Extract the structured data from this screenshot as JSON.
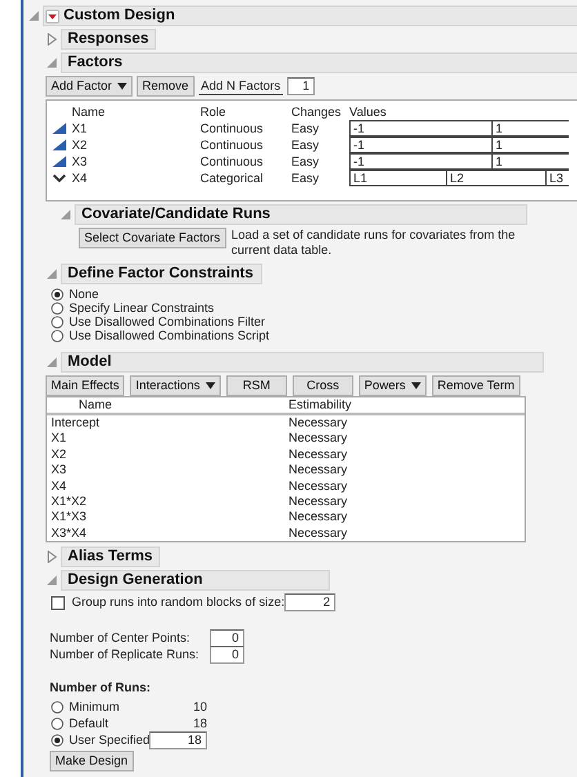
{
  "report": {
    "title": "Custom Design",
    "expanded": true
  },
  "responses": {
    "title": "Responses",
    "expanded": false
  },
  "factors": {
    "title": "Factors",
    "expanded": true,
    "toolbar": {
      "add_factor": "Add Factor",
      "remove": "Remove",
      "add_n_label": "Add N Factors",
      "add_n_value": "1"
    },
    "columns": [
      "Name",
      "Role",
      "Changes",
      "Values"
    ],
    "rows": [
      {
        "kind": "continuous",
        "name": "X1",
        "role": "Continuous",
        "changes": "Easy",
        "values": [
          "-1",
          "1"
        ]
      },
      {
        "kind": "continuous",
        "name": "X2",
        "role": "Continuous",
        "changes": "Easy",
        "values": [
          "-1",
          "1"
        ]
      },
      {
        "kind": "continuous",
        "name": "X3",
        "role": "Continuous",
        "changes": "Easy",
        "values": [
          "-1",
          "1"
        ]
      },
      {
        "kind": "categorical",
        "name": "X4",
        "role": "Categorical",
        "changes": "Easy",
        "values": [
          "L1",
          "L2",
          "L3"
        ]
      }
    ]
  },
  "covariate": {
    "title": "Covariate/Candidate Runs",
    "expanded": true,
    "button": "Select Covariate Factors",
    "description": "Load a set of candidate runs for covariates from the current data table."
  },
  "constraints": {
    "title": "Define Factor Constraints",
    "expanded": true,
    "options": [
      {
        "label": "None",
        "selected": true
      },
      {
        "label": "Specify Linear Constraints",
        "selected": false
      },
      {
        "label": "Use Disallowed Combinations Filter",
        "selected": false
      },
      {
        "label": "Use Disallowed Combinations Script",
        "selected": false
      }
    ]
  },
  "model": {
    "title": "Model",
    "expanded": true,
    "buttons": [
      {
        "label": "Main Effects",
        "kind": "plain"
      },
      {
        "label": "Interactions",
        "kind": "menu"
      },
      {
        "label": "RSM",
        "kind": "plain"
      },
      {
        "label": "Cross",
        "kind": "plain"
      },
      {
        "label": "Powers",
        "kind": "menu"
      },
      {
        "label": "Remove Term",
        "kind": "plain"
      }
    ],
    "columns": [
      "Name",
      "Estimability"
    ],
    "rows": [
      [
        "Intercept",
        "Necessary"
      ],
      [
        "X1",
        "Necessary"
      ],
      [
        "X2",
        "Necessary"
      ],
      [
        "X3",
        "Necessary"
      ],
      [
        "X4",
        "Necessary"
      ],
      [
        "X1*X2",
        "Necessary"
      ],
      [
        "X1*X3",
        "Necessary"
      ],
      [
        "X3*X4",
        "Necessary"
      ]
    ]
  },
  "alias_terms": {
    "title": "Alias Terms",
    "expanded": false
  },
  "design_generation": {
    "title": "Design Generation",
    "expanded": true,
    "group_runs": {
      "label": "Group runs into random blocks of size:",
      "checked": false,
      "value": "2"
    },
    "center_points": {
      "label": "Number of Center Points:",
      "value": "0"
    },
    "replicate_runs": {
      "label": "Number of Replicate Runs:",
      "value": "0"
    },
    "runs_heading": "Number of Runs:",
    "run_options": [
      {
        "kind": "fixed",
        "label": "Minimum",
        "value": "10",
        "selected": false
      },
      {
        "kind": "fixed",
        "label": "Default",
        "value": "18",
        "selected": false
      },
      {
        "kind": "input",
        "label": "User Specified",
        "value": "18",
        "selected": true
      }
    ],
    "make_design": "Make Design"
  }
}
